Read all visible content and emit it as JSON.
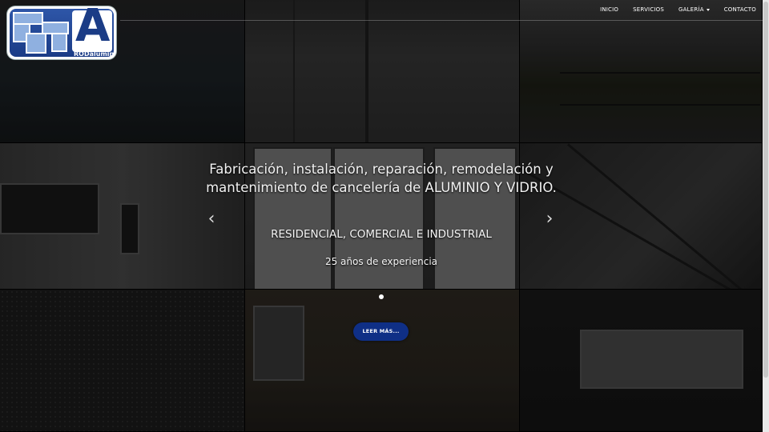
{
  "logo": {
    "text": "RODaluminio"
  },
  "nav": {
    "items": [
      {
        "label": "INICIO"
      },
      {
        "label": "SERVICIOS"
      },
      {
        "label": "GALERÍA"
      },
      {
        "label": "CONTACTO"
      }
    ]
  },
  "hero": {
    "headline_line1": "Fabricación, instalación, reparación, remodelación y",
    "headline_line2": "mantenimiento de cancelería de ALUMINIO Y VIDRIO.",
    "subhead": "RESIDENCIAL, COMERCIAL E INDUSTRIAL",
    "experience": "25 años de experiencia",
    "prev_icon": "chevron-left-icon",
    "next_icon": "chevron-right-icon",
    "button_label": "LEER MÁS...",
    "button_color": "#0f2f86"
  }
}
